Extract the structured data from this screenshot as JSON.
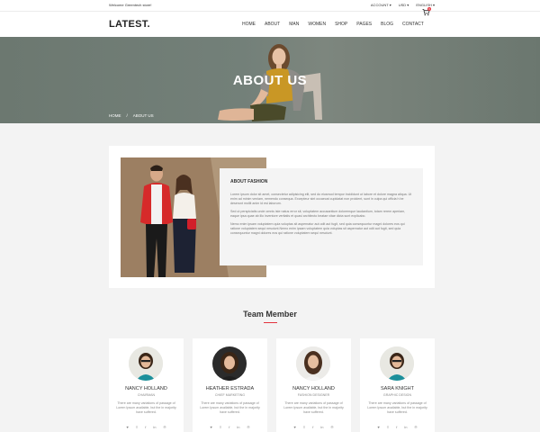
{
  "topbar": {
    "welcome": "Welcome Greentech store!",
    "account": "ACCOUNT",
    "currency": "USD",
    "language": "ENGLISH"
  },
  "header": {
    "logo": "LATEST.",
    "nav": [
      "HOME",
      "ABOUT",
      "MAN",
      "WOMEN",
      "SHOP",
      "PAGES",
      "BLOG",
      "CONTACT"
    ],
    "cart_count": "0"
  },
  "banner": {
    "title": "ABOUT US",
    "breadcrumb": [
      "HOME",
      "/",
      "ABOUT US"
    ]
  },
  "about": {
    "heading": "ABOUT FASHION",
    "paragraphs": [
      "Lorem ipsum dolor sit amet, consectetur adipisicing elit, sed do eiusmod tempor incididunt ut labore et dolore magna aliqua. Ut enim ad minim veniam, nemendo consequa. Excepteur sint occaecat cupidatat non proident, sunt in culpa qui officia h be deserunt mollit anim id est laborum.",
      "Sed ut perspiciatis unde omnis iste natus error sit, voluptatem accusantium doloremque laudantium, totam rerem aperiam, eaque ipsa quae ab illo inventore veritatis et quasi architecto beatae vitae dicta sunt explicabo.",
      "Nemo enim ipsam voluptatem quia voluptas sit aspernatur aut odit aut fugit, sed quia consequuntur magni dolores eos qui ratione voluptatem sequi nesciunt.Nemo enim ipsam voluptatem quia voluptas sit aspernatur aut odit aut fugit, sed quia consequuntur magni dolores eos qui ratione voluptatem sequi nesciunt."
    ]
  },
  "team": {
    "title": "Team Member",
    "members": [
      {
        "name": "NANCY HOLLAND",
        "role": "CHAIRMAN",
        "desc": "There are many variations of passage of Lorem Ipsum available, but the in majority have suffered."
      },
      {
        "name": "HEATHER ESTRADA",
        "role": "CHIEF MARKETING",
        "desc": "There are many variations of passage of Lorem Ipsum available, but the in majority have suffered."
      },
      {
        "name": "NANCY HOLLAND",
        "role": "FASHION DESIGNER",
        "desc": "There are many variations of passage of Lorem Ipsum available, but the in majority have suffered."
      },
      {
        "name": "SARA KNIGHT",
        "role": "GRAPHIC DESIGN",
        "desc": "There are many variations of passage of Lorem Ipsum available, but the in majority have suffered."
      }
    ],
    "social_icons": [
      "twitter-icon",
      "rss-icon",
      "facebook-icon",
      "linkedin-icon",
      "pinterest-icon"
    ],
    "social_glyphs": [
      "♥",
      "≡",
      "f",
      "in",
      "℗"
    ]
  },
  "colors": {
    "accent": "#e3333d",
    "banner_overlay": "#6d7a72"
  }
}
